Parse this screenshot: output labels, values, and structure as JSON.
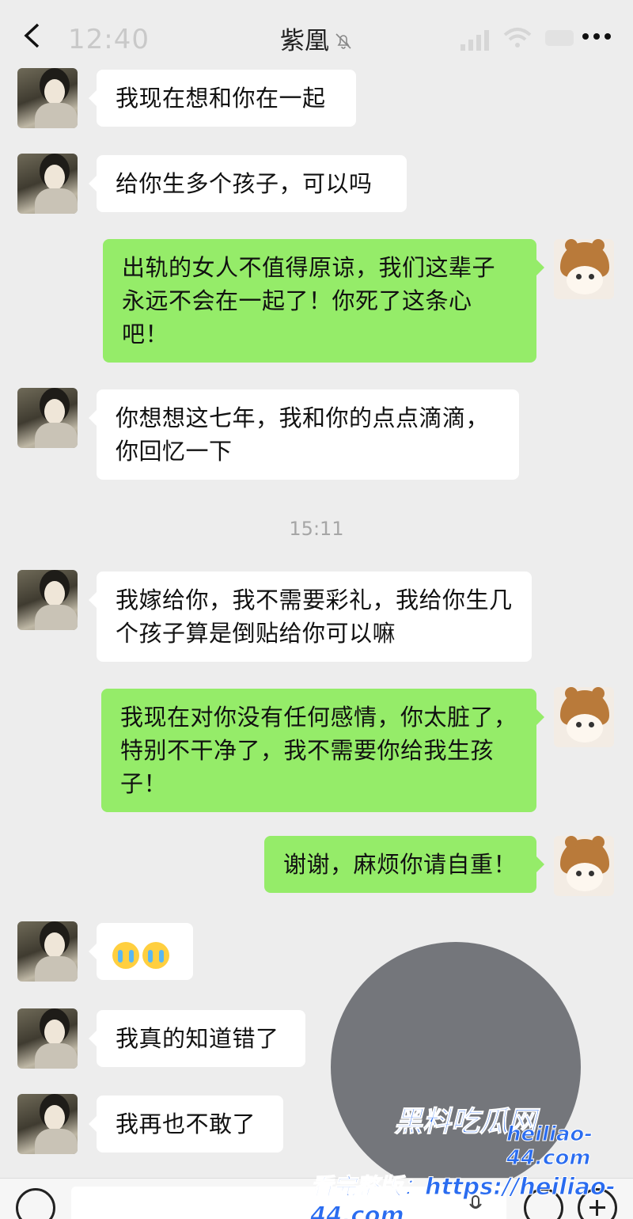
{
  "status_bar": {
    "time": "12:40"
  },
  "header": {
    "title": "紫凰",
    "back_icon": "chevron-left-icon",
    "mute_icon": "bell-off-icon",
    "more_icon": "more-dots-icon"
  },
  "messages": [
    {
      "sender": "contact",
      "text": "我现在想和你在一起"
    },
    {
      "sender": "contact",
      "text": "给你生多个孩子，可以吗"
    },
    {
      "sender": "me",
      "text": "出轨的女人不值得原谅，我们这辈子永远不会在一起了！你死了这条心吧！"
    },
    {
      "sender": "contact",
      "text": "你想想这七年，我和你的点点滴滴，你回忆一下"
    },
    {
      "sender": "contact",
      "text": "我嫁给你，我不需要彩礼，我给你生几个孩子算是倒贴给你可以嘛"
    },
    {
      "sender": "me",
      "text": "我现在对你没有任何感情，你太脏了，特别不干净了，我不需要你给我生孩子！"
    },
    {
      "sender": "me",
      "text": "谢谢，麻烦你请自重！"
    },
    {
      "sender": "contact",
      "text": "",
      "emoji": "crying-face-emoji"
    },
    {
      "sender": "contact",
      "text": "我真的知道错了"
    },
    {
      "sender": "contact",
      "text": "我再也不敢了"
    }
  ],
  "timestamp": "15:11",
  "watermark": {
    "logo": "黑料吃瓜网",
    "url": "heiliao-44.com",
    "footer": "看完整版：https://heiliao-44.com"
  },
  "colors": {
    "background": "#ededed",
    "incoming_bubble": "#ffffff",
    "outgoing_bubble": "#95ec69",
    "watermark": "#2a6cf0"
  }
}
